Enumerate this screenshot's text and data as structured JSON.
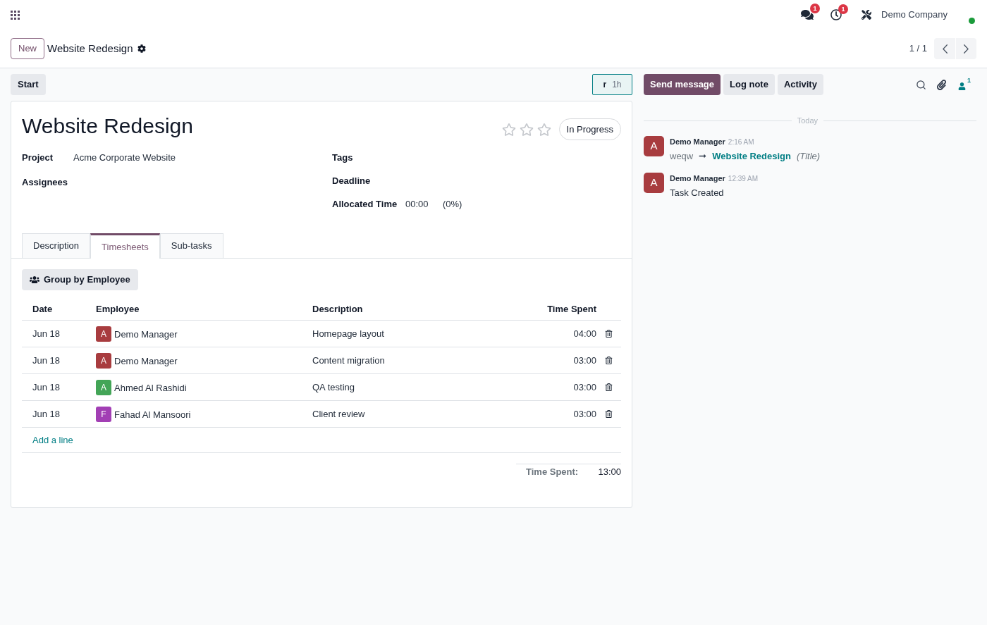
{
  "navbar": {
    "notifications": [
      {
        "kind": "messages",
        "count": "1"
      },
      {
        "kind": "activities",
        "count": "1"
      }
    ],
    "company": "Demo Company"
  },
  "control_panel": {
    "new_button": "New",
    "breadcrumb": "Website Redesign",
    "pager": "1 / 1"
  },
  "status_bar": {
    "start_button": "Start",
    "timer": {
      "key": "r",
      "duration": "1h"
    }
  },
  "form": {
    "title": "Website Redesign",
    "stars": 0,
    "stage": "In Progress",
    "fields_left": [
      {
        "label": "Project",
        "value": "Acme Corporate Website"
      },
      {
        "label": "Assignees"
      }
    ],
    "fields_right": [
      {
        "label": "Tags"
      },
      {
        "label": "Deadline"
      },
      {
        "label": "Allocated Time",
        "value": "00:00",
        "percentage": "(0%)"
      }
    ],
    "tabs": [
      {
        "label": "Description",
        "selected": false
      },
      {
        "label": "Timesheets",
        "selected": true
      },
      {
        "label": "Sub-tasks",
        "selected": false
      }
    ],
    "timesheets": {
      "group_button": "Group by Employee",
      "columns": [
        "Date",
        "Employee",
        "Description",
        "Time Spent"
      ],
      "rows": [
        {
          "date": "Jun 18",
          "employee_initial": "A",
          "employee": "Demo Manager",
          "color": "#a83c3f",
          "description": "Homepage layout",
          "time": "04:00"
        },
        {
          "date": "Jun 18",
          "employee_initial": "A",
          "employee": "Demo Manager",
          "color": "#a83c3f",
          "description": "Content migration",
          "time": "03:00"
        },
        {
          "date": "Jun 18",
          "employee_initial": "A",
          "employee": "Ahmed Al Rashidi",
          "color": "#43a557",
          "description": "QA testing",
          "time": "03:00"
        },
        {
          "date": "Jun 18",
          "employee_initial": "F",
          "employee": "Fahad Al Mansoori",
          "color": "#a23fb4",
          "description": "Client review",
          "time": "03:00"
        }
      ],
      "add_line": "Add a line",
      "total_label": "Time Spent:",
      "total_value": "13:00"
    }
  },
  "chatter": {
    "buttons": [
      {
        "label": "Send message",
        "selected": true
      },
      {
        "label": "Log note",
        "selected": false
      },
      {
        "label": "Activity",
        "selected": false
      }
    ],
    "followers_count": "1",
    "date_separator": "Today",
    "messages": [
      {
        "kind": "tracking",
        "initial": "A",
        "author": "Demo Manager",
        "time": "2:16 AM",
        "old_value": "weqw",
        "new_value": "Website Redesign",
        "field": "(Title)"
      },
      {
        "kind": "note",
        "initial": "A",
        "author": "Demo Manager",
        "time": "12:39 AM",
        "body": "Task Created"
      }
    ]
  }
}
